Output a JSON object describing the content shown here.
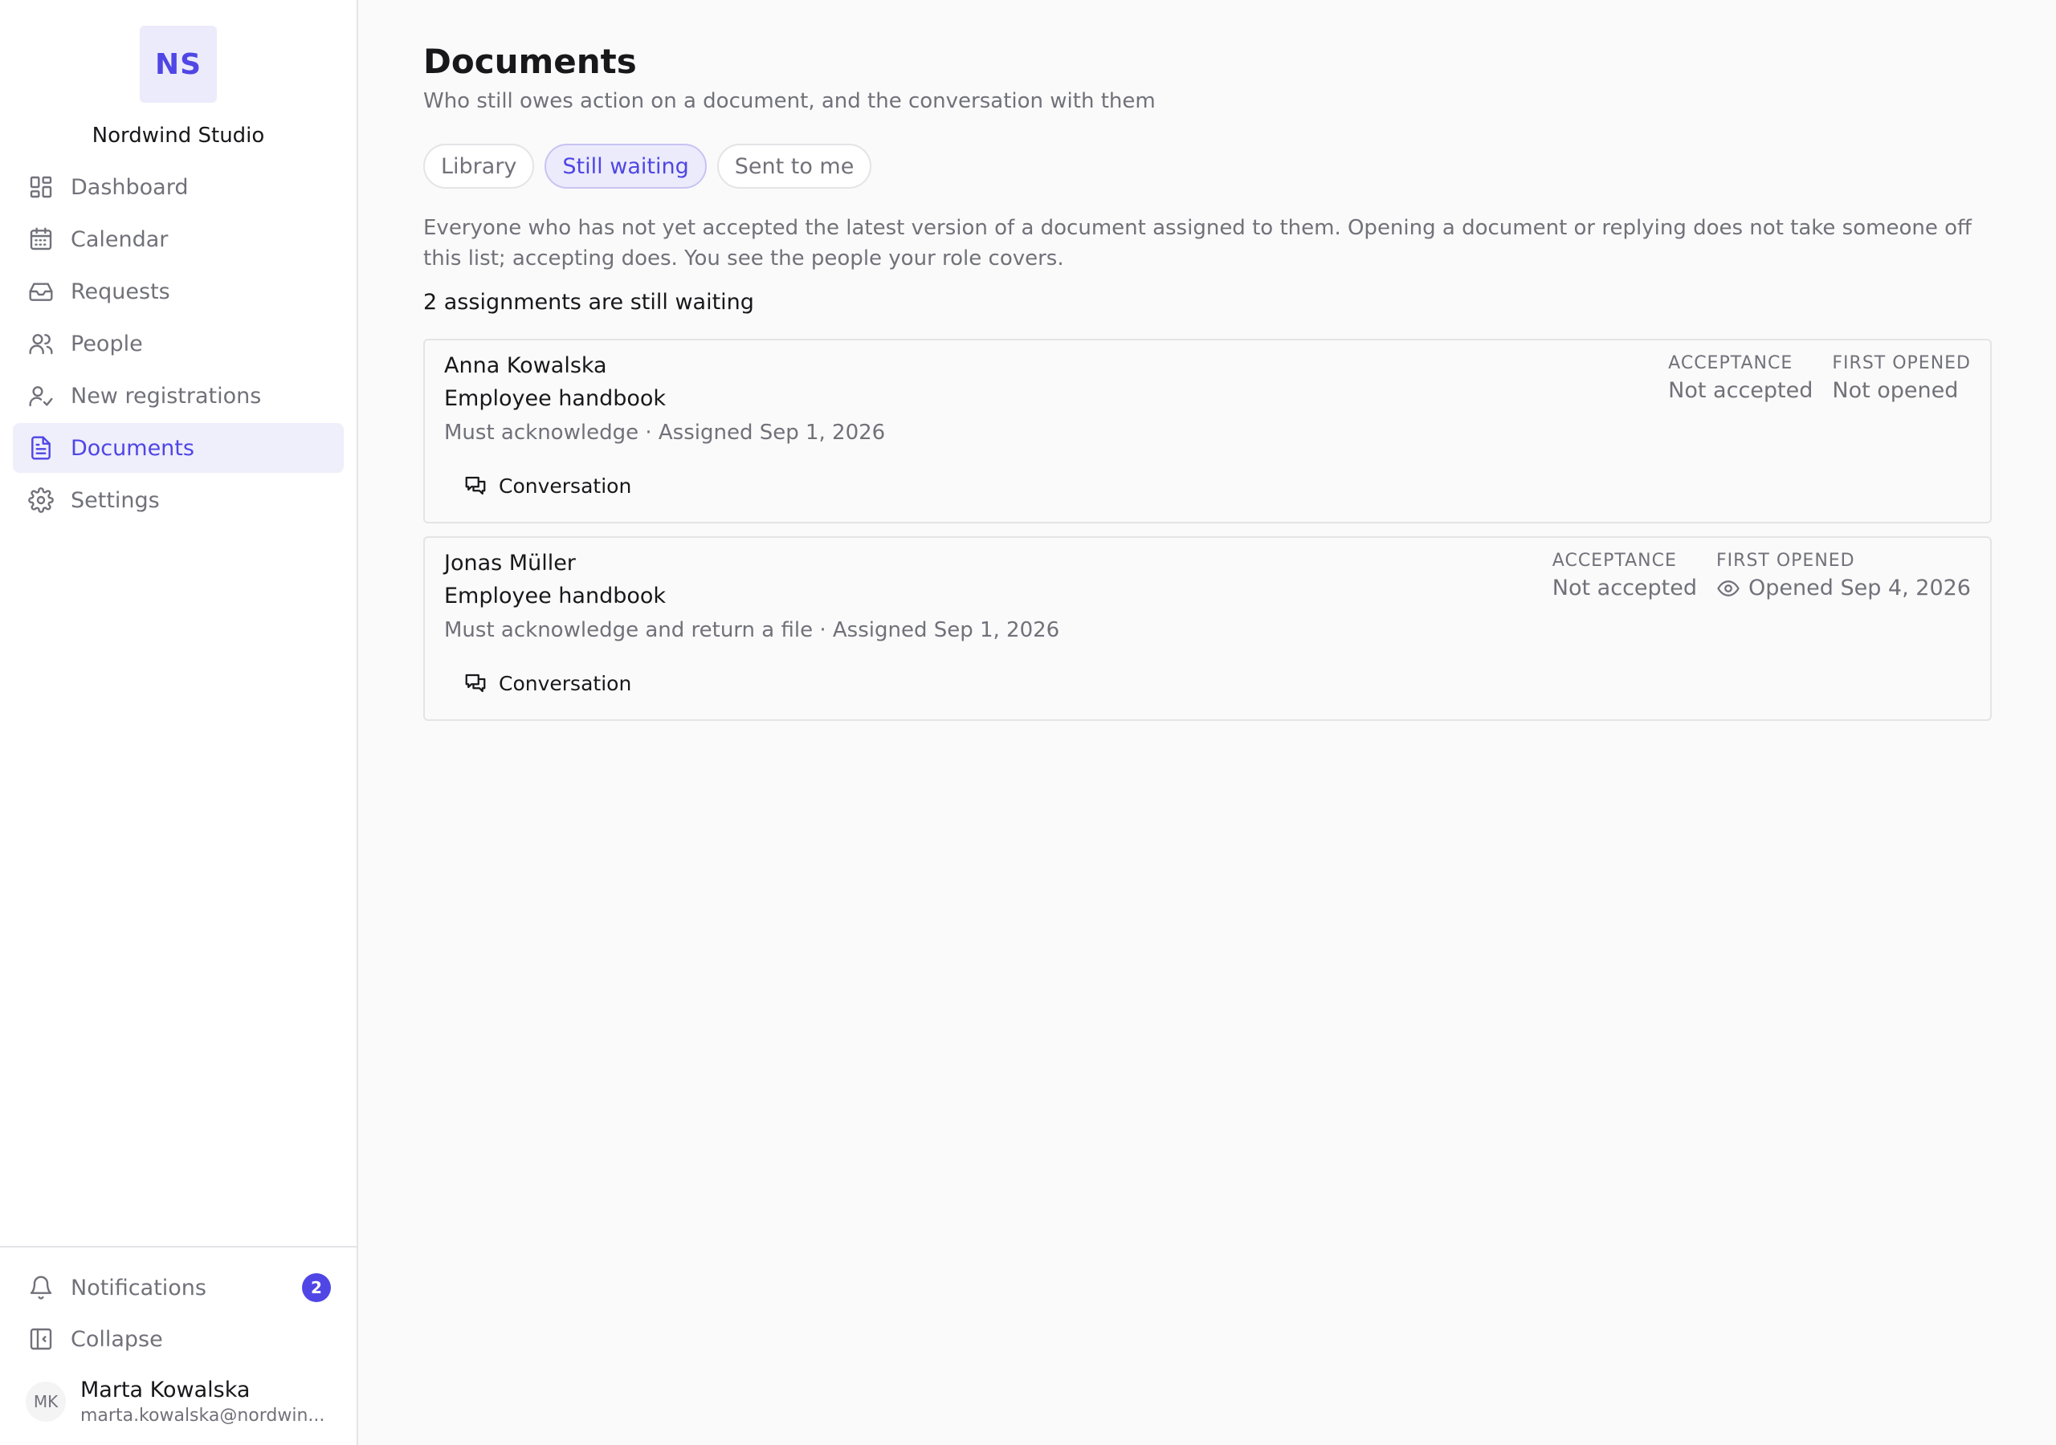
{
  "org": {
    "initials": "NS",
    "name": "Nordwind Studio"
  },
  "nav": {
    "items": [
      {
        "label": "Dashboard",
        "icon": "dashboard-icon"
      },
      {
        "label": "Calendar",
        "icon": "calendar-icon"
      },
      {
        "label": "Requests",
        "icon": "inbox-icon"
      },
      {
        "label": "People",
        "icon": "people-icon"
      },
      {
        "label": "New registrations",
        "icon": "user-check-icon"
      },
      {
        "label": "Documents",
        "icon": "document-icon",
        "active": true
      },
      {
        "label": "Settings",
        "icon": "gear-icon"
      }
    ]
  },
  "footer": {
    "notifications_label": "Notifications",
    "notifications_count": "2",
    "collapse_label": "Collapse"
  },
  "user": {
    "initials": "MK",
    "name": "Marta Kowalska",
    "email": "marta.kowalska@nordwin..."
  },
  "page": {
    "title": "Documents",
    "subtitle": "Who still owes action on a document, and the conversation with them"
  },
  "tabs": [
    {
      "label": "Library"
    },
    {
      "label": "Still waiting",
      "active": true
    },
    {
      "label": "Sent to me"
    }
  ],
  "description": "Everyone who has not yet accepted the latest version of a document assigned to them. Opening a document or replying does not take someone off this list; accepting does. You see the people your role covers.",
  "count_text": "2 assignments are still waiting",
  "assignments": [
    {
      "person": "Anna Kowalska",
      "document": "Employee handbook",
      "meta": "Must acknowledge · Assigned Sep 1, 2026",
      "acceptance_label": "ACCEPTANCE",
      "acceptance_value": "Not accepted",
      "first_opened_label": "FIRST OPENED",
      "first_opened_value": "Not opened",
      "conversation_label": "Conversation"
    },
    {
      "person": "Jonas Müller",
      "document": "Employee handbook",
      "meta": "Must acknowledge and return a file · Assigned Sep 1, 2026",
      "acceptance_label": "ACCEPTANCE",
      "acceptance_value": "Not accepted",
      "first_opened_label": "FIRST OPENED",
      "first_opened_value": "Opened Sep 4, 2026",
      "conversation_label": "Conversation"
    }
  ],
  "colors": {
    "accent": "#4f46e5",
    "accent_bg": "#ecebfb"
  }
}
